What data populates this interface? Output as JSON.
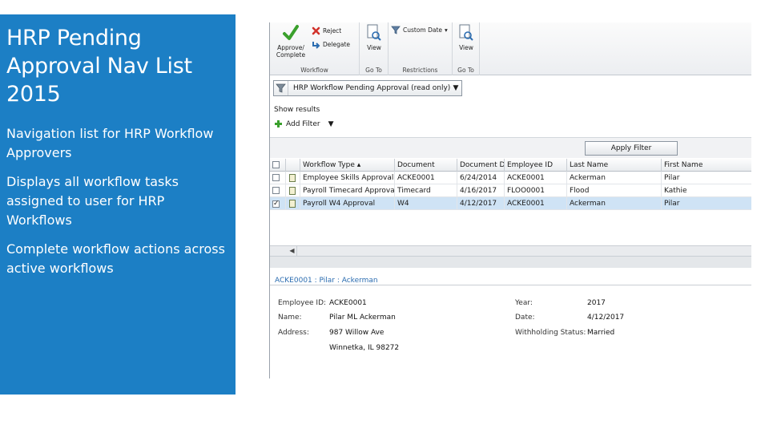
{
  "slide": {
    "title": "HRP Pending Approval Nav List 2015",
    "bullets": [
      "Navigation list for HRP Workflow Approvers",
      "Displays all workflow tasks assigned to user for HRP Workflows",
      "Complete workflow actions across active workflows"
    ]
  },
  "ribbon": {
    "approve_label": "Approve/ Complete",
    "reject_label": "Reject",
    "delegate_label": "Delegate",
    "workflow_group": "Workflow",
    "view_label": "View",
    "goto_group": "Go To",
    "custom_date_label": "Custom Date",
    "restrictions_group": "Restrictions",
    "view2_label": "View",
    "goto2_group": "Go To"
  },
  "filter": {
    "selected": "HRP Workflow Pending Approval (read only)"
  },
  "show_results": "Show results",
  "add_filter": "Add Filter",
  "apply_filter": "Apply Filter",
  "grid": {
    "columns": [
      "Workflow Type",
      "Document",
      "Document D",
      "Employee ID",
      "Last Name",
      "First Name"
    ],
    "rows": [
      {
        "checked": false,
        "selected": false,
        "cells": [
          "Employee Skills Approval",
          "ACKE0001",
          "6/24/2014",
          "ACKE0001",
          "Ackerman",
          "Pilar"
        ]
      },
      {
        "checked": false,
        "selected": false,
        "cells": [
          "Payroll Timecard Approval",
          "Timecard",
          "4/16/2017",
          "FLOO0001",
          "Flood",
          "Kathie"
        ]
      },
      {
        "checked": true,
        "selected": true,
        "cells": [
          "Payroll W4 Approval",
          "W4",
          "4/12/2017",
          "ACKE0001",
          "Ackerman",
          "Pilar"
        ]
      }
    ]
  },
  "detail": {
    "title": "ACKE0001 : Pilar : Ackerman",
    "employee_id_label": "Employee ID:",
    "employee_id": "ACKE0001",
    "name_label": "Name:",
    "name": "Pilar ML Ackerman",
    "address_label": "Address:",
    "address_line1": "987 Willow Ave",
    "address_line2": "Winnetka, IL 98272",
    "year_label": "Year:",
    "year": "2017",
    "date_label": "Date:",
    "date": "4/12/2017",
    "withholding_label": "Withholding Status:",
    "withholding": "Married"
  },
  "colors": {
    "side_panel": "#1c7fc5",
    "selected_row": "#cfe3f5",
    "approve_check": "#3aa02c",
    "reject_x": "#d1322b"
  }
}
